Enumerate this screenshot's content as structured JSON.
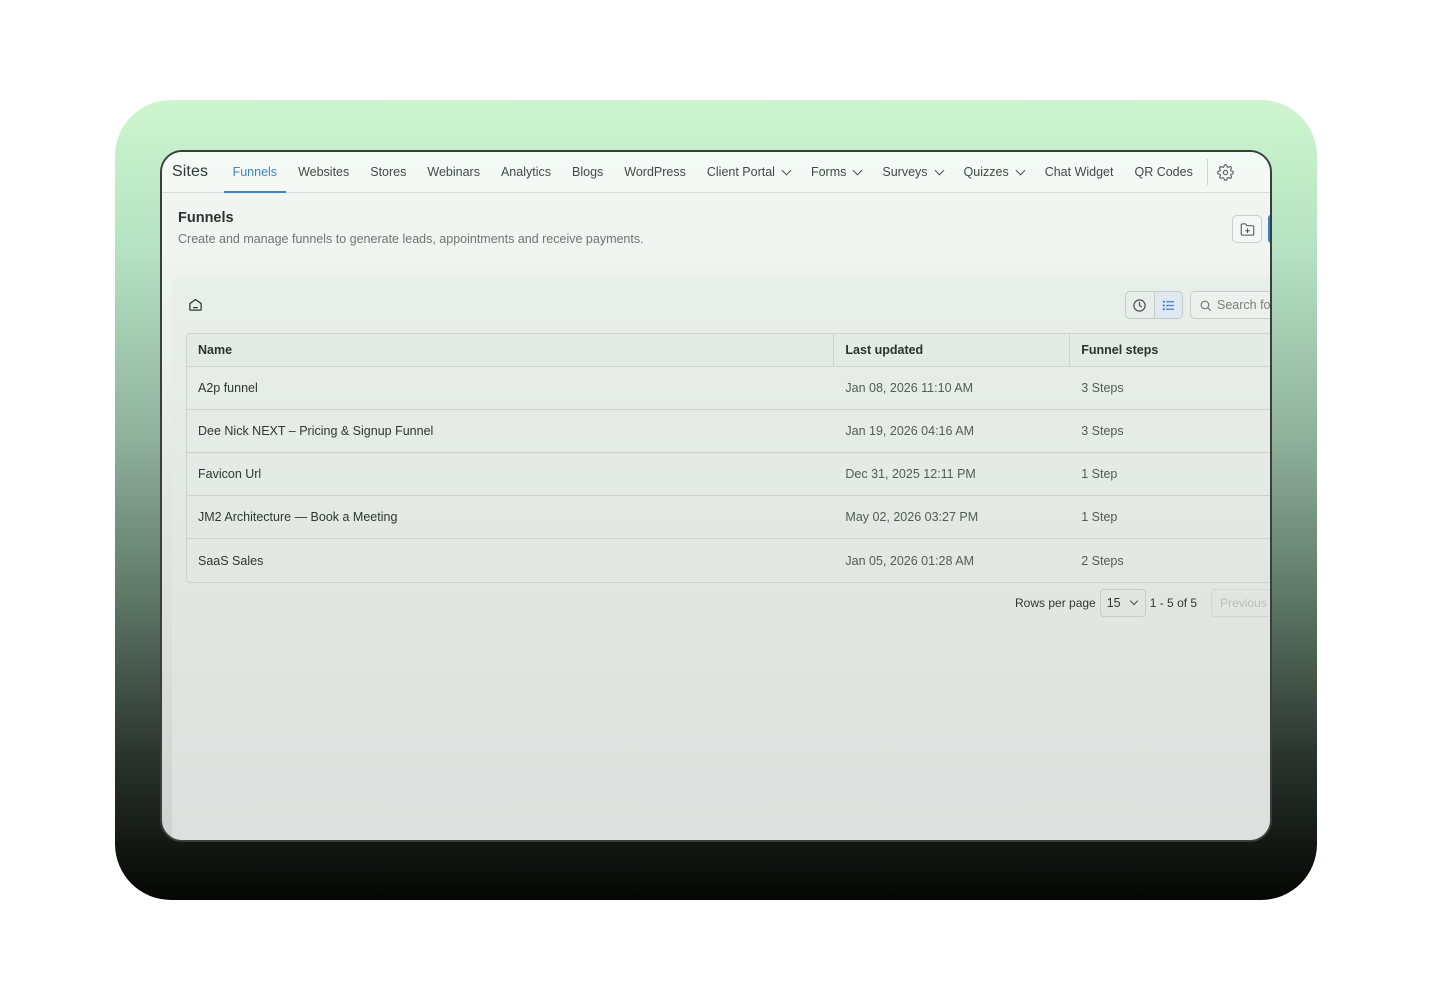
{
  "nav": {
    "brand": "Sites",
    "items": [
      {
        "label": "Funnels",
        "active": true,
        "dropdown": false
      },
      {
        "label": "Websites",
        "active": false,
        "dropdown": false
      },
      {
        "label": "Stores",
        "active": false,
        "dropdown": false
      },
      {
        "label": "Webinars",
        "active": false,
        "dropdown": false
      },
      {
        "label": "Analytics",
        "active": false,
        "dropdown": false
      },
      {
        "label": "Blogs",
        "active": false,
        "dropdown": false
      },
      {
        "label": "WordPress",
        "active": false,
        "dropdown": false
      },
      {
        "label": "Client Portal",
        "active": false,
        "dropdown": true
      },
      {
        "label": "Forms",
        "active": false,
        "dropdown": true
      },
      {
        "label": "Surveys",
        "active": false,
        "dropdown": true
      },
      {
        "label": "Quizzes",
        "active": false,
        "dropdown": true
      },
      {
        "label": "Chat Widget",
        "active": false,
        "dropdown": false
      },
      {
        "label": "QR Codes",
        "active": false,
        "dropdown": false
      }
    ],
    "settings_icon": "gear-icon",
    "accent_color": "#3a86c8"
  },
  "header": {
    "title": "Funnels",
    "subtitle": "Create and manage funnels to generate leads, appointments and receive payments."
  },
  "toolbar": {
    "search_placeholder": "Search fo",
    "view_active": "list"
  },
  "table": {
    "columns": [
      "Name",
      "Last updated",
      "Funnel steps"
    ],
    "rows": [
      {
        "name": "A2p funnel",
        "updated": "Jan 08, 2026 11:10 AM",
        "steps": "3 Steps"
      },
      {
        "name": "Dee Nick NEXT – Pricing & Signup Funnel",
        "updated": "Jan 19, 2026 04:16 AM",
        "steps": "3 Steps"
      },
      {
        "name": "Favicon Url",
        "updated": "Dec 31, 2025 12:11 PM",
        "steps": "1 Step"
      },
      {
        "name": "JM2 Architecture — Book a Meeting",
        "updated": "May 02, 2026 03:27 PM",
        "steps": "1 Step"
      },
      {
        "name": "SaaS Sales",
        "updated": "Jan 05, 2026 01:28 AM",
        "steps": "2 Steps"
      }
    ]
  },
  "pagination": {
    "rows_per_page_label": "Rows per page",
    "rows_per_page": "15",
    "range": "1 - 5 of 5",
    "previous_label": "Previous"
  }
}
